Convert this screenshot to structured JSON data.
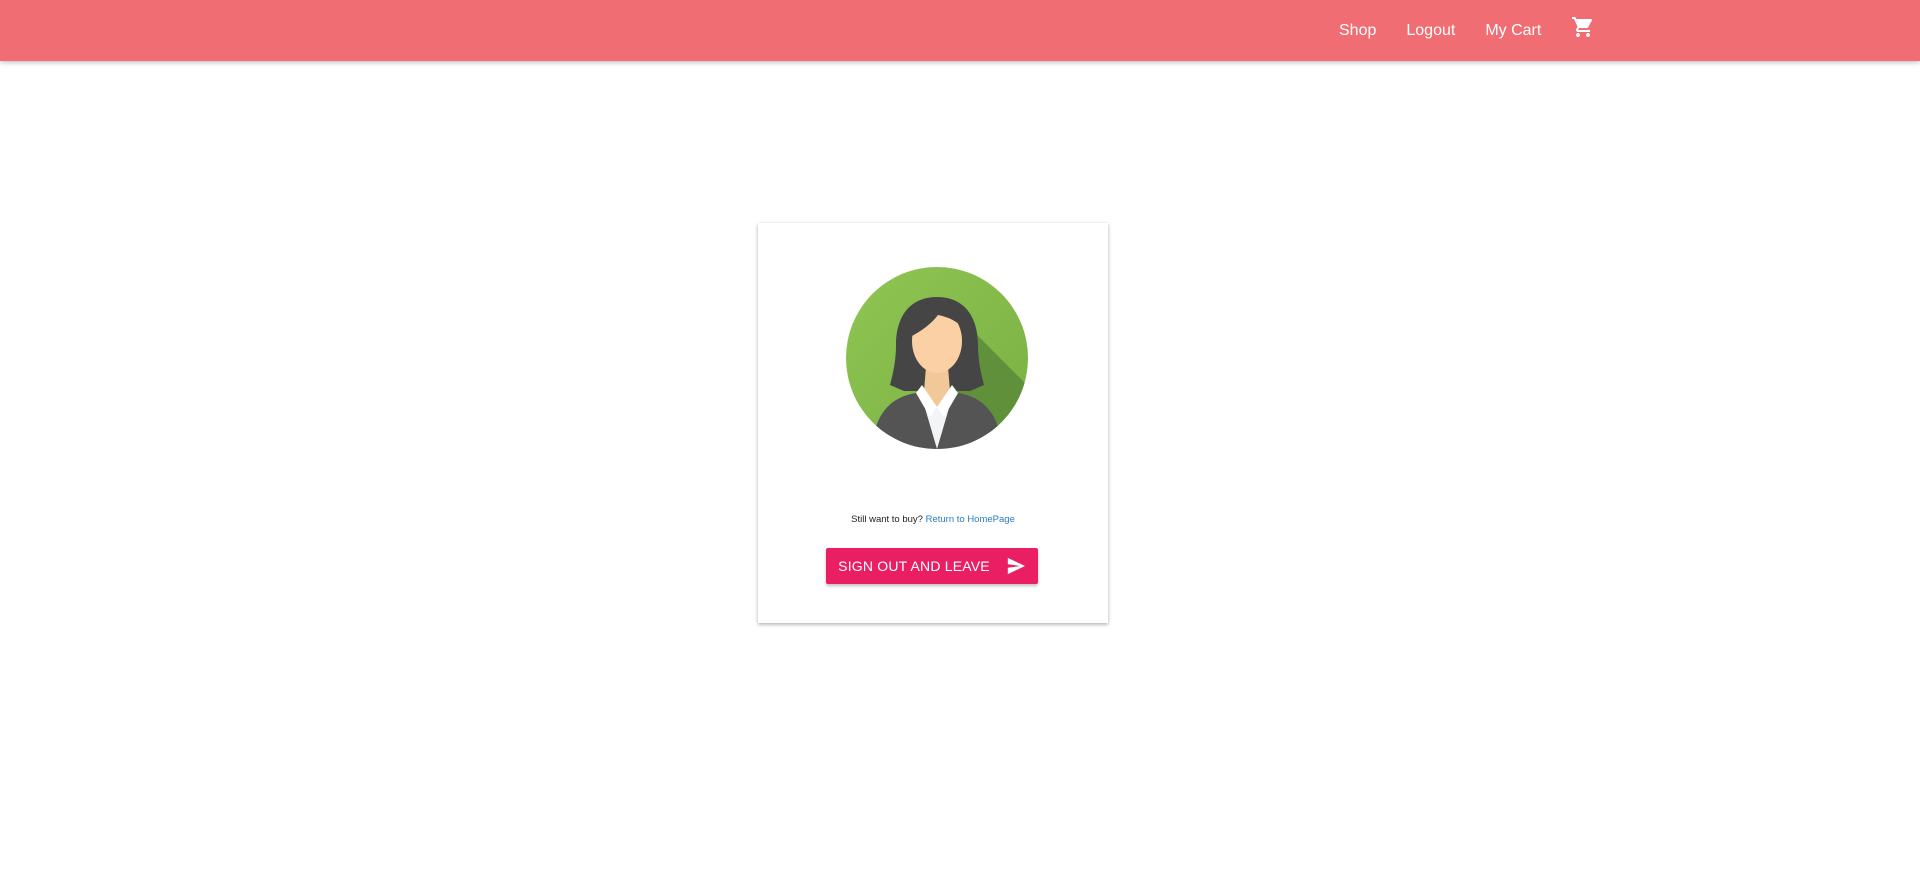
{
  "nav": {
    "links": [
      "Shop",
      "Logout",
      "My Cart"
    ],
    "cart_icon": "shopping-cart-icon",
    "background_color": "#f06d73"
  },
  "card": {
    "avatar_icon": "user-avatar-female",
    "prompt_text": "Still want to buy?",
    "return_link": "Return to HomePage",
    "signout_button": "SIGN OUT AND LEAVE",
    "signout_icon": "send-icon",
    "button_color": "#e91e63"
  }
}
